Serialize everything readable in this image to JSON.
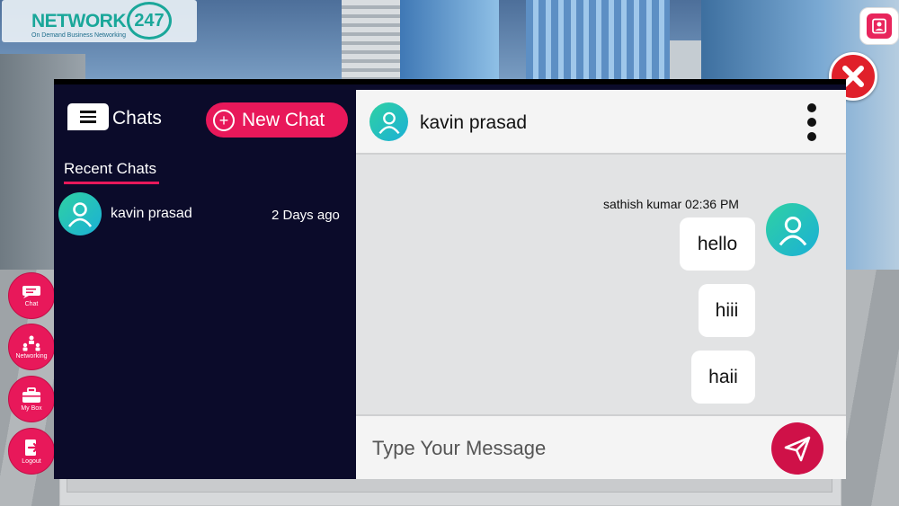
{
  "logo": {
    "brand": "NETWORK",
    "number": "247",
    "tagline": "On Demand Business Networking"
  },
  "side_menu": [
    {
      "label": "Chat",
      "icon": "chat-icon"
    },
    {
      "label": "Networking",
      "icon": "networking-icon"
    },
    {
      "label": "My Box",
      "icon": "briefcase-icon"
    },
    {
      "label": "Logout",
      "icon": "logout-icon"
    }
  ],
  "left": {
    "title": "Chats",
    "new_chat_label": "New Chat",
    "recent_tab": "Recent Chats",
    "recent_chats": [
      {
        "name": "kavin prasad",
        "time": "2 Days ago"
      }
    ]
  },
  "conversation": {
    "contact_name": "kavin prasad",
    "meta": "sathish kumar 02:36 PM",
    "messages": [
      "hello",
      "hiii",
      "haii"
    ],
    "input_placeholder": "Type Your Message",
    "input_value": ""
  },
  "colors": {
    "accent": "#e8185a",
    "panel_dark": "#0b0b2a",
    "close": "#e0202a",
    "avatar_gradient_start": "#2fd1a3",
    "avatar_gradient_end": "#1bb0d6"
  }
}
